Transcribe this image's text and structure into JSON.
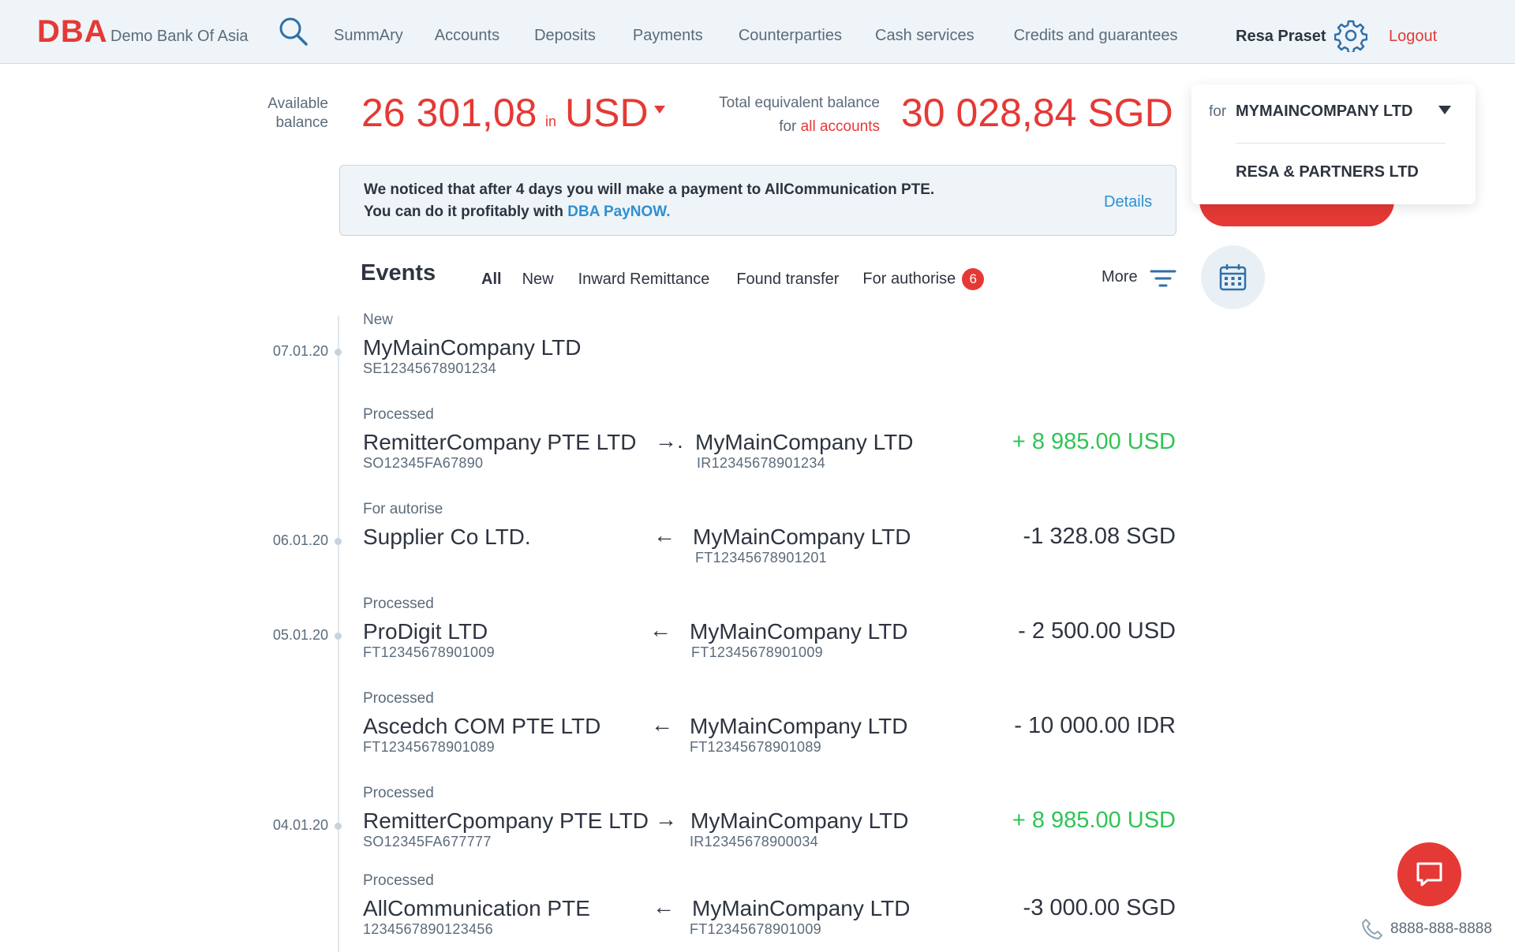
{
  "header": {
    "logo": "DBA",
    "bank_name": "Demo Bank Of Asia",
    "nav": [
      "SummAry",
      "Accounts",
      "Deposits",
      "Payments",
      "Counterparties",
      "Cash services",
      "Credits and guarantees"
    ],
    "user_name": "Resa Praset",
    "logout": "Logout"
  },
  "balance": {
    "available_label": "Available balance",
    "available_amount": "26 301,08",
    "in_word": "in",
    "currency": "USD",
    "total_label_line1": "Total equivalent balance",
    "total_label_for": "for",
    "total_label_accent": "all accounts",
    "total_amount": "30 028,84 SGD"
  },
  "company_select": {
    "for": "for",
    "selected": "MYMAINCOMPANY LTD",
    "options": [
      "RESA & PARTNERS LTD"
    ]
  },
  "notice": {
    "text": "We noticed that after 4 days you will make a payment to AllCommunication PTE. You can do it profitably with",
    "link": "DBA PayNOW.",
    "details": "Details"
  },
  "events": {
    "title": "Events",
    "filters": [
      "All",
      "New",
      "Inward Remittance",
      "Found transfer",
      "For authorise"
    ],
    "authorise_count": "6",
    "more": "More",
    "dates": [
      "07.01.20",
      "06.01.20",
      "05.01.20",
      "04.01.20"
    ],
    "items": [
      {
        "status": "New",
        "name": "MyMainCompany LTD",
        "account": "SE12345678901234",
        "arrow": "",
        "counterparty": "",
        "counterparty_account": "",
        "amount": ""
      },
      {
        "status": "Processed",
        "name": "RemitterCompany PTE LTD",
        "account": "SO12345FA67890",
        "arrow": "→.",
        "counterparty": "MyMainCompany LTD",
        "counterparty_account": "IR12345678901234",
        "amount": "+ 8 985.00 USD"
      },
      {
        "status": "For autorise",
        "name": "Supplier Co LTD.",
        "account": "",
        "arrow": "←",
        "counterparty": "MyMainCompany LTD",
        "counterparty_account": "FT12345678901201",
        "amount": "-1 328.08 SGD"
      },
      {
        "status": "Processed",
        "name": "ProDigit LTD",
        "account": "FT12345678901009",
        "arrow": "←",
        "counterparty": "MyMainCompany LTD",
        "counterparty_account": "FT12345678901009",
        "amount": "- 2 500.00 USD"
      },
      {
        "status": "Processed",
        "name": "Ascedch COM PTE LTD",
        "account": "FT12345678901089",
        "arrow": "←",
        "counterparty": "MyMainCompany LTD",
        "counterparty_account": "FT12345678901089",
        "amount": "- 10 000.00 IDR"
      },
      {
        "status": "Processed",
        "name": "RemitterCpompany PTE LTD",
        "account": "SO12345FA677777",
        "arrow": "→",
        "counterparty": "MyMainCompany LTD",
        "counterparty_account": "IR12345678900034",
        "amount": "+ 8 985.00 USD"
      },
      {
        "status": "Processed",
        "name": "AllCommunication PTE",
        "account": "1234567890123456",
        "arrow": "←",
        "counterparty": "MyMainCompany LTD",
        "counterparty_account": "FT12345678901009",
        "amount": "-3 000.00 SGD"
      }
    ]
  },
  "support": {
    "phone": "8888-888-8888"
  },
  "colors": {
    "accent": "#e53935",
    "positive": "#2fc455",
    "link": "#2f8fd1",
    "header_bg": "#eef4f8"
  },
  "icons": [
    "search-icon",
    "gear-icon",
    "caret-down-icon",
    "filter-icon",
    "calendar-icon",
    "chat-icon",
    "phone-icon"
  ]
}
